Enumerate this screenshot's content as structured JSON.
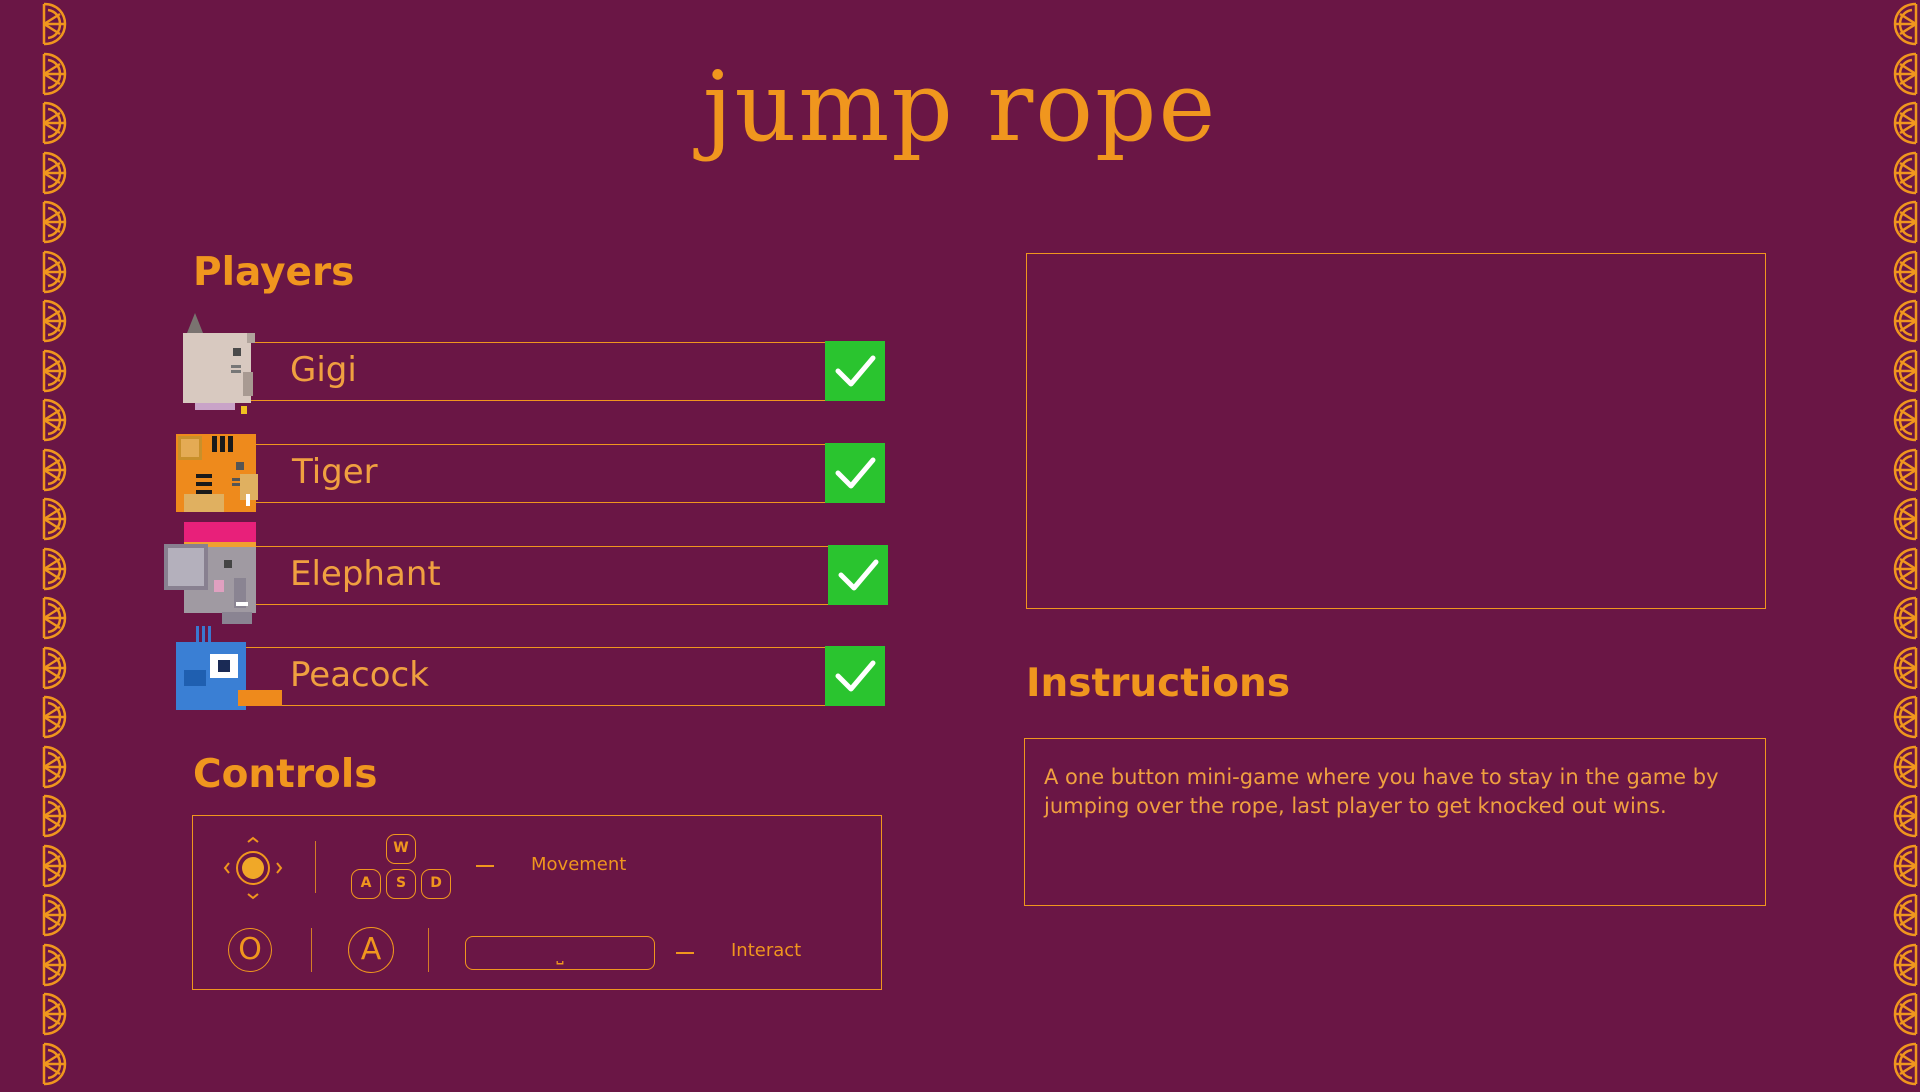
{
  "title": "jump rope",
  "players": {
    "heading": "Players",
    "items": [
      {
        "name": "Gigi",
        "ready": true
      },
      {
        "name": "Tiger",
        "ready": true
      },
      {
        "name": "Elephant",
        "ready": true
      },
      {
        "name": "Peacock",
        "ready": true
      }
    ]
  },
  "controls": {
    "heading": "Controls",
    "keys": {
      "w": "W",
      "a": "A",
      "s": "S",
      "d": "D"
    },
    "movement_label": "Movement",
    "interact_label": "Interact",
    "button_a": "A",
    "button_o": "O",
    "space_glyph": "⎵"
  },
  "instructions": {
    "heading": "Instructions",
    "text": "A one button mini-game where  you have to stay in the game by jumping over the rope, last player to get knocked out wins."
  },
  "colors": {
    "background": "#6a1645",
    "accent": "#f0961e",
    "check": "#2ac42f"
  }
}
